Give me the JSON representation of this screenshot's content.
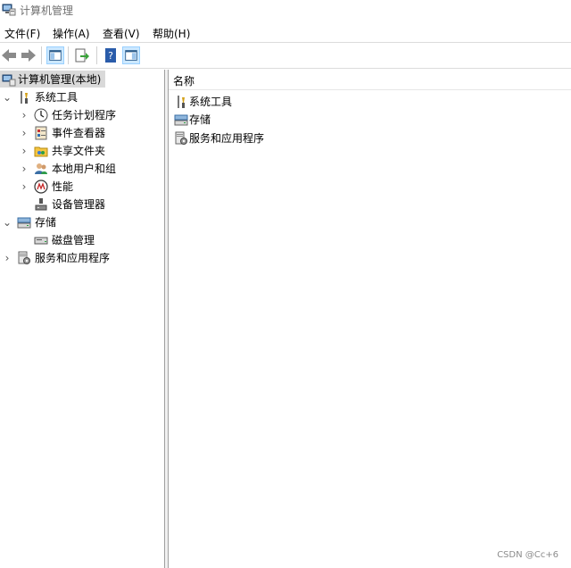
{
  "window": {
    "title": "计算机管理"
  },
  "menu": [
    "文件(F)",
    "操作(A)",
    "查看(V)",
    "帮助(H)"
  ],
  "tree": {
    "root": "计算机管理(本地)",
    "system_tools": "系统工具",
    "task_scheduler": "任务计划程序",
    "event_viewer": "事件查看器",
    "shared_folders": "共享文件夹",
    "local_users": "本地用户和组",
    "performance": "性能",
    "device_manager": "设备管理器",
    "storage": "存储",
    "disk_management": "磁盘管理",
    "services_apps": "服务和应用程序"
  },
  "list": {
    "column_name": "名称",
    "items": [
      "系统工具",
      "存储",
      "服务和应用程序"
    ]
  },
  "watermark": "CSDN @Cc+6",
  "colors": {
    "selection": "#d9d9d9",
    "pressed_button": "#cce8ff"
  }
}
